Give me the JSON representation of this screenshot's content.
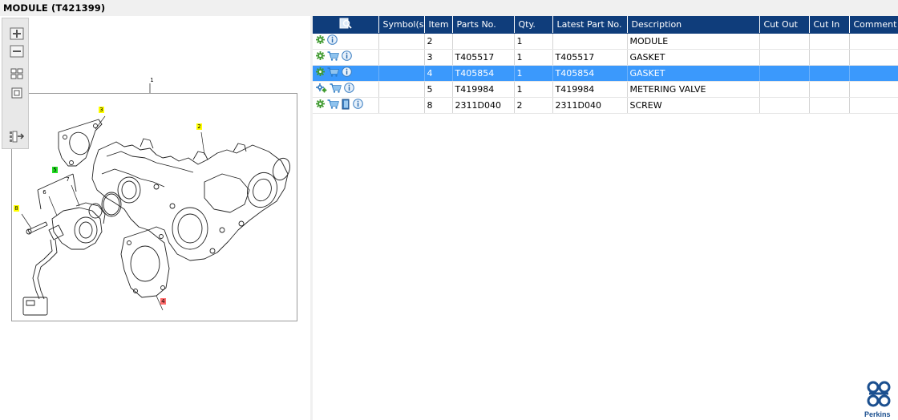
{
  "window": {
    "title": "MODULE (T421399)"
  },
  "toolbar": {
    "buttons": [
      {
        "name": "zoom-in",
        "icon": "zoom-in-icon"
      },
      {
        "name": "zoom-out",
        "icon": "zoom-out-icon"
      },
      {
        "name": "fit-all",
        "icon": "fit-all-icon"
      },
      {
        "name": "actual-size",
        "icon": "actual-size-icon"
      },
      {
        "name": "export",
        "icon": "export-icon"
      }
    ]
  },
  "diagram": {
    "callouts": [
      "1",
      "2",
      "3",
      "4",
      "5",
      "6",
      "7",
      "8"
    ]
  },
  "grid": {
    "columns": [
      "",
      "Symbol(s)",
      "Item",
      "Parts No.",
      "Qty.",
      "Latest Part No.",
      "Description",
      "Cut Out",
      "Cut In",
      "Comment"
    ],
    "rows": [
      {
        "icons": [
          "gear-icon",
          "info-icon"
        ],
        "symbols": "",
        "item": "2",
        "parts_no": "",
        "qty": "1",
        "latest_part_no": "",
        "description": "MODULE",
        "cut_out": "",
        "cut_in": "",
        "comment": "",
        "selected": false
      },
      {
        "icons": [
          "gear-icon",
          "cart-icon",
          "info-icon"
        ],
        "symbols": "",
        "item": "3",
        "parts_no": "T405517",
        "qty": "1",
        "latest_part_no": "T405517",
        "description": "GASKET",
        "cut_out": "",
        "cut_in": "",
        "comment": "",
        "selected": false
      },
      {
        "icons": [
          "gear-icon",
          "cart-icon",
          "info-icon"
        ],
        "symbols": "",
        "item": "4",
        "parts_no": "T405854",
        "qty": "1",
        "latest_part_no": "T405854",
        "description": "GASKET",
        "cut_out": "",
        "cut_in": "",
        "comment": "",
        "selected": true
      },
      {
        "icons": [
          "gears-icon",
          "cart-icon",
          "info-icon"
        ],
        "symbols": "",
        "item": "5",
        "parts_no": "T419984",
        "qty": "1",
        "latest_part_no": "T419984",
        "description": "METERING VALVE",
        "cut_out": "",
        "cut_in": "",
        "comment": "",
        "selected": false
      },
      {
        "icons": [
          "gear-icon",
          "cart-icon",
          "book-icon",
          "info-icon"
        ],
        "symbols": "",
        "item": "8",
        "parts_no": "2311D040",
        "qty": "2",
        "latest_part_no": "2311D040",
        "description": "SCREW",
        "cut_out": "",
        "cut_in": "",
        "comment": "",
        "selected": false
      }
    ]
  },
  "brand": {
    "name": "Perkins",
    "color": "#1b4f8f"
  },
  "colors": {
    "header": "#0f3d7b",
    "selection": "#3b99fc",
    "callout_yellow": "#ffff00",
    "callout_green": "#22dd22",
    "callout_red": "#ff6b6b"
  }
}
